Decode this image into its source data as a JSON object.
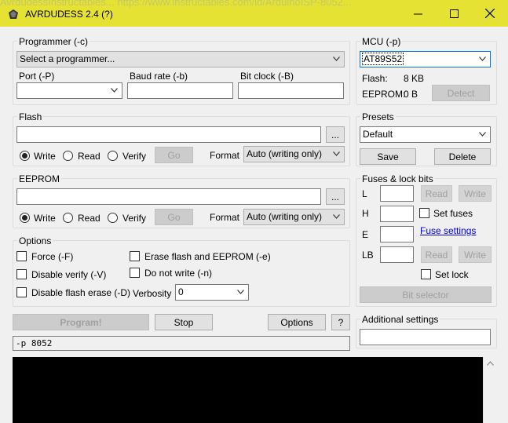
{
  "window": {
    "title": "AVRDUDESS 2.4 (?)",
    "bg_url": "AvrdudessInstructables... https://www.instructables.com/id/ArduinoISP-8052..."
  },
  "programmer": {
    "group_label": "Programmer (-c)",
    "selected": "Select a programmer...",
    "port_label": "Port (-P)",
    "baud_label": "Baud rate (-b)",
    "bitclock_label": "Bit clock (-B)"
  },
  "mcu": {
    "group_label": "MCU (-p)",
    "selected": "AT89S52",
    "flash_label": "Flash:",
    "flash_value": "8 KB",
    "eeprom_label": "EEPROM:",
    "eeprom_value": "0 B",
    "detect_label": "Detect"
  },
  "flash": {
    "group_label": "Flash",
    "browse_label": "...",
    "write_label": "Write",
    "read_label": "Read",
    "verify_label": "Verify",
    "go_label": "Go",
    "format_label": "Format",
    "format_value": "Auto (writing only)"
  },
  "presets": {
    "group_label": "Presets",
    "selected": "Default",
    "save_label": "Save",
    "delete_label": "Delete"
  },
  "eeprom": {
    "group_label": "EEPROM",
    "browse_label": "...",
    "write_label": "Write",
    "read_label": "Read",
    "verify_label": "Verify",
    "go_label": "Go",
    "format_label": "Format",
    "format_value": "Auto (writing only)"
  },
  "fuses": {
    "group_label": "Fuses & lock bits",
    "l_label": "L",
    "h_label": "H",
    "e_label": "E",
    "lb_label": "LB",
    "read_label": "Read",
    "write_label": "Write",
    "set_fuses_label": "Set fuses",
    "fuse_settings_label": "Fuse settings",
    "set_lock_label": "Set lock",
    "bit_selector_label": "Bit selector"
  },
  "options": {
    "group_label": "Options",
    "force_label": "Force (-F)",
    "erase_label": "Erase flash and EEPROM (-e)",
    "disable_verify_label": "Disable verify (-V)",
    "no_write_label": "Do not write (-n)",
    "disable_erase_label": "Disable flash erase (-D)",
    "verbosity_label": "Verbosity",
    "verbosity_value": "0"
  },
  "actions": {
    "program_label": "Program!",
    "stop_label": "Stop",
    "options_label": "Options",
    "help_label": "?"
  },
  "additional": {
    "group_label": "Additional settings"
  },
  "command": {
    "text": "-p 8052"
  }
}
